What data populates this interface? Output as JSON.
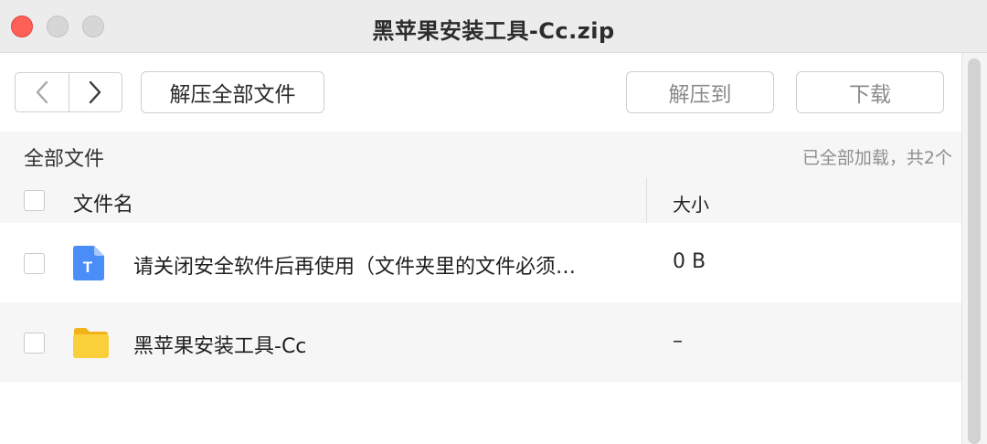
{
  "window": {
    "title": "黑苹果安装工具-Cc.zip"
  },
  "toolbar": {
    "back_icon": "chevron-left-icon",
    "forward_icon": "chevron-right-icon",
    "extract_all_label": "解压全部文件",
    "extract_to_label": "解压到",
    "download_label": "下载"
  },
  "breadcrumb": {
    "current": "全部文件",
    "status": "已全部加载，共2个"
  },
  "table": {
    "columns": {
      "name": "文件名",
      "size": "大小"
    },
    "rows": [
      {
        "icon": "text-file-icon",
        "icon_letter": "T",
        "name": "请关闭安全软件后再使用（文件夹里的文件必须…",
        "size": "0 B",
        "checked": false
      },
      {
        "icon": "folder-icon",
        "name": "黑苹果安装工具-Cc",
        "size": "–",
        "checked": false
      }
    ]
  },
  "colors": {
    "close_button": "#fe5f57",
    "file_icon_blue": "#4b8df8",
    "folder_yellow": "#f9cf3a",
    "row_alt_background": "#f6f6f6"
  }
}
